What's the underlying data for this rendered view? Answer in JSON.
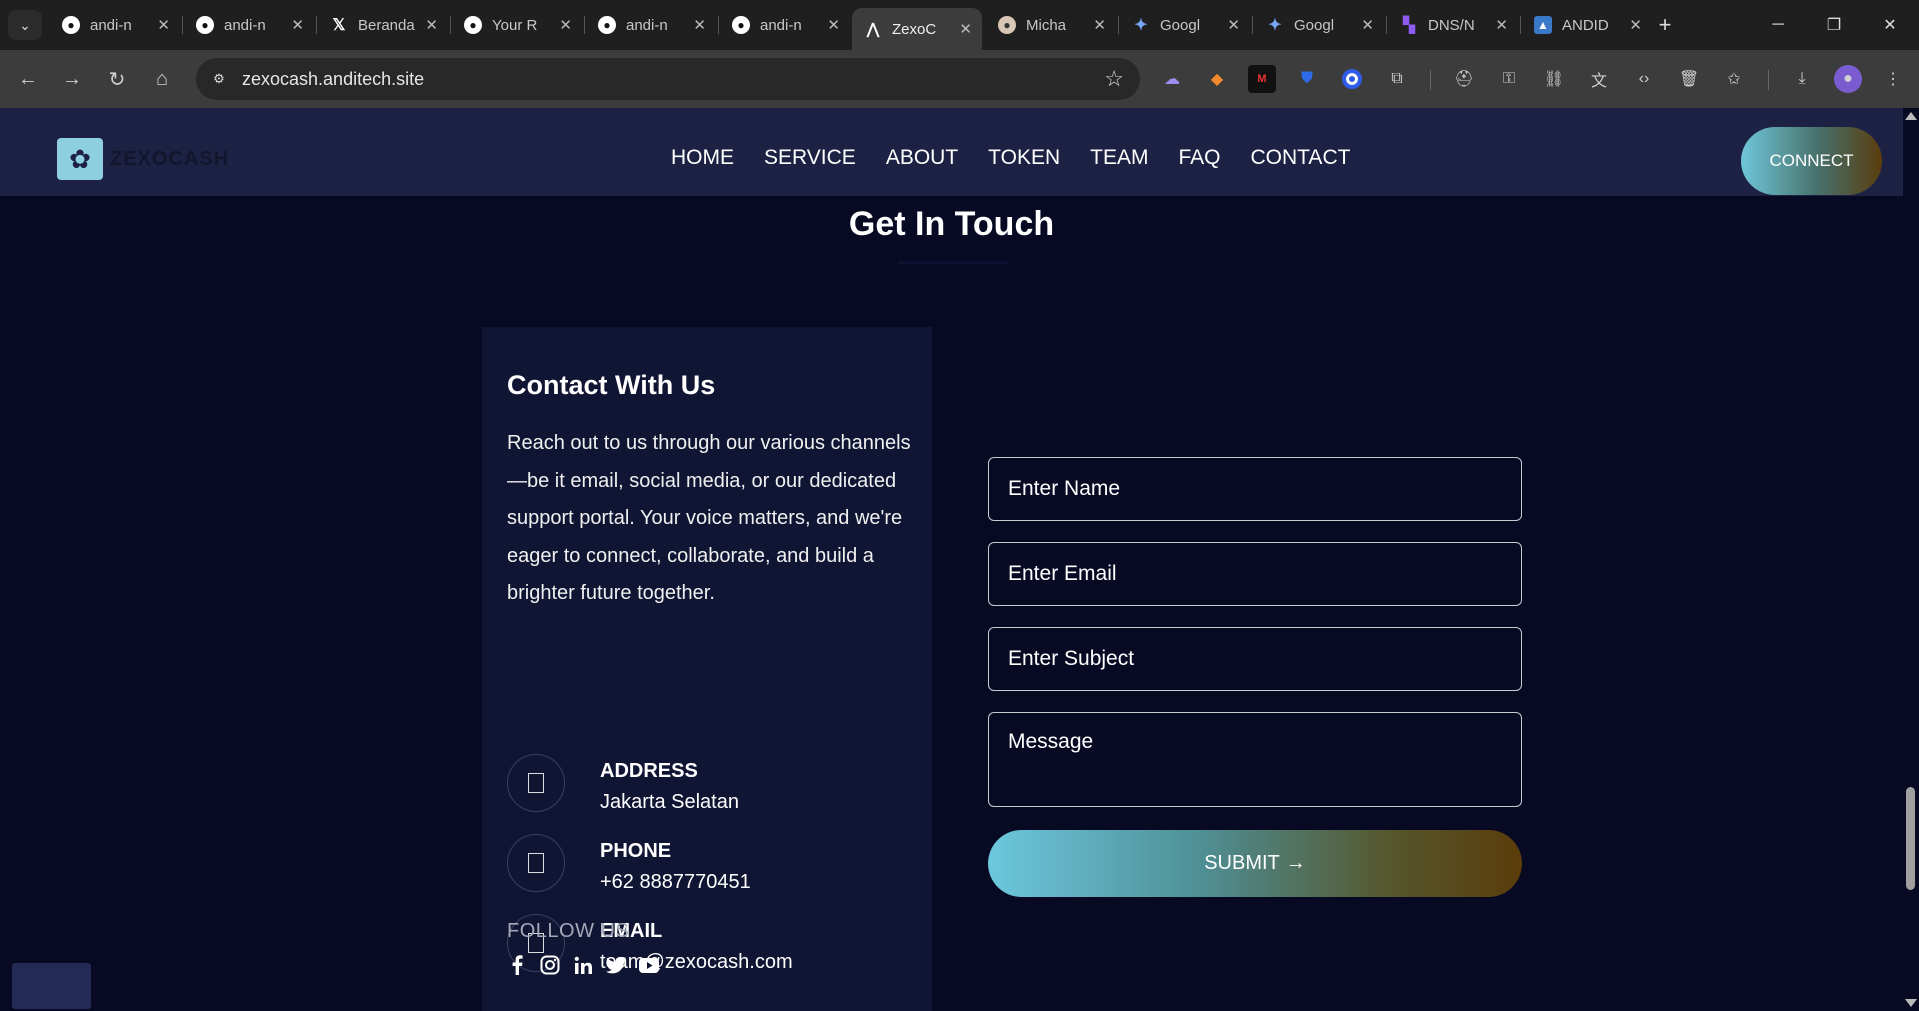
{
  "browser": {
    "tabs": [
      {
        "title": "andi-n",
        "favicon": "github-icon",
        "active": false
      },
      {
        "title": "andi-n",
        "favicon": "github-icon",
        "active": false
      },
      {
        "title": "Beranda",
        "favicon": "x-icon",
        "active": false
      },
      {
        "title": "Your R",
        "favicon": "github-icon",
        "active": false
      },
      {
        "title": "andi-n",
        "favicon": "github-icon",
        "active": false
      },
      {
        "title": "andi-n",
        "favicon": "github-icon",
        "active": false
      },
      {
        "title": "ZexoC",
        "favicon": "zexo-icon",
        "active": true
      },
      {
        "title": "Micha",
        "favicon": "profile-icon",
        "active": false
      },
      {
        "title": "Googl",
        "favicon": "gemini-icon",
        "active": false
      },
      {
        "title": "Googl",
        "favicon": "gemini-icon",
        "active": false
      },
      {
        "title": "DNS/N",
        "favicon": "dns-icon",
        "active": false
      },
      {
        "title": "ANDID",
        "favicon": "andid-icon",
        "active": false
      }
    ],
    "url": "zexocash.anditech.site"
  },
  "site": {
    "logo_text": "ZEXOCASH",
    "nav": [
      "HOME",
      "SERVICE",
      "ABOUT",
      "TOKEN",
      "TEAM",
      "FAQ",
      "CONTACT"
    ],
    "connect_label": "CONNECT"
  },
  "contact": {
    "section_title": "Get In Touch",
    "card_title": "Contact With Us",
    "description": "Reach out to us through our various channels—be it email, social media, or our dedicated support portal. Your voice matters, and we're eager to connect, collaborate, and build a brighter future together.",
    "address_label": "ADDRESS",
    "address_value": "Jakarta Selatan",
    "phone_label": "PHONE",
    "phone_value": "+62 8887770451",
    "email_label": "EMAIL",
    "email_value": "team@zexocash.com",
    "follow_label": "FOLLOW US",
    "socials": [
      "facebook-icon",
      "instagram-icon",
      "linkedin-icon",
      "twitter-icon",
      "youtube-icon"
    ]
  },
  "form": {
    "name_placeholder": "Enter Name",
    "email_placeholder": "Enter Email",
    "subject_placeholder": "Enter Subject",
    "message_placeholder": "Message",
    "submit_label": "SUBMIT",
    "submit_arrow": "→"
  },
  "colors": {
    "page_bg": "#070a22",
    "header_bg": "#1d2244",
    "card_bg": "#101533",
    "gradient_start": "#6cc7de",
    "gradient_end": "#5b3c0a"
  }
}
